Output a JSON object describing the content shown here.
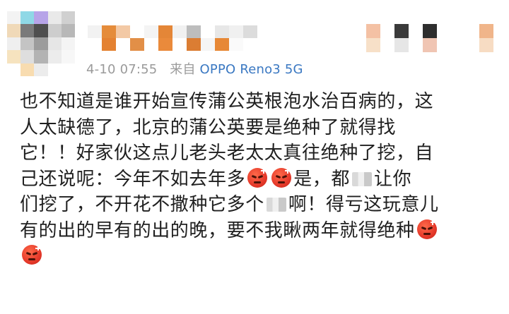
{
  "post": {
    "timestamp": "4-10 07:55",
    "via_prefix": "来自",
    "device": "OPPO Reno3 5G",
    "lines": [
      [
        "也不知道是谁开始宣传蒲公英根泡水治百病的，这"
      ],
      [
        "人太缺德了，北京的蒲公英要是绝种了就得找"
      ],
      [
        "它！！好家伙这点儿老头老太太真往绝种了挖，自"
      ],
      [
        "己还说呢：今年不如去年多",
        "[angry]",
        "[angry]",
        "是，都",
        "[blur]",
        "让你"
      ],
      [
        "们挖了，不开花不撒种它多个",
        "[blur]",
        "啊！得亏这玩意儿"
      ],
      [
        "有的出的早有的出的晚，要不我瞅两年就得绝种",
        "[angry]"
      ],
      [
        "[angry]"
      ]
    ]
  },
  "mosaic": {
    "avatar_colors": [
      "#f3f3f3",
      "#8fd8e6",
      "#b7a4e8",
      "#e9e9e9",
      "#d0d0d0",
      "#f0d9b8",
      "#7a7a7a",
      "#4f4f4f",
      "#cdcdcd",
      "#b8b8b8",
      "#efefef",
      "#c4c4c4",
      "#9c9c9c",
      "#e6e6e6",
      "#f4f4f4",
      "#f6e3bf",
      "#dedede",
      "#b3b3b3",
      "#ececec",
      "#f7f7f7",
      "#ffffff",
      "#f8dcb0",
      "#ececec",
      "#ffffff",
      "#ffffff"
    ],
    "name_colors": [
      "#f2f2f2",
      "#e58c3a",
      "#f3c9a5",
      "#ffffff",
      "#f4f4f4",
      "#e48637",
      "#f1f1f1",
      "#bdbdbd",
      "#ffffff",
      "#e7e7e7",
      "#f0f0f0",
      "#dcdcdc",
      "#ffffff",
      "#e48232",
      "#ffffff",
      "#e28f47",
      "#ffffff",
      "#ea8a3b",
      "#ffffff",
      "#db7d33",
      "#f5f5f5",
      "#e78836",
      "#fafafa",
      "#ffffff"
    ],
    "badge_colors": [
      "#ffffff",
      "#f4c1a4",
      "#ffffff",
      "#3a3a3a",
      "#ffffff",
      "#2e2e2e",
      "#ffffff",
      "#ffffff",
      "#ffffff",
      "#f0b58a",
      "#ffffff",
      "#f7e0c8",
      "#ffffff",
      "#e6e6e6",
      "#ffffff",
      "#f0c5b3",
      "#ffffff",
      "#ffffff",
      "#ffffff",
      "#f7dcc3"
    ]
  }
}
